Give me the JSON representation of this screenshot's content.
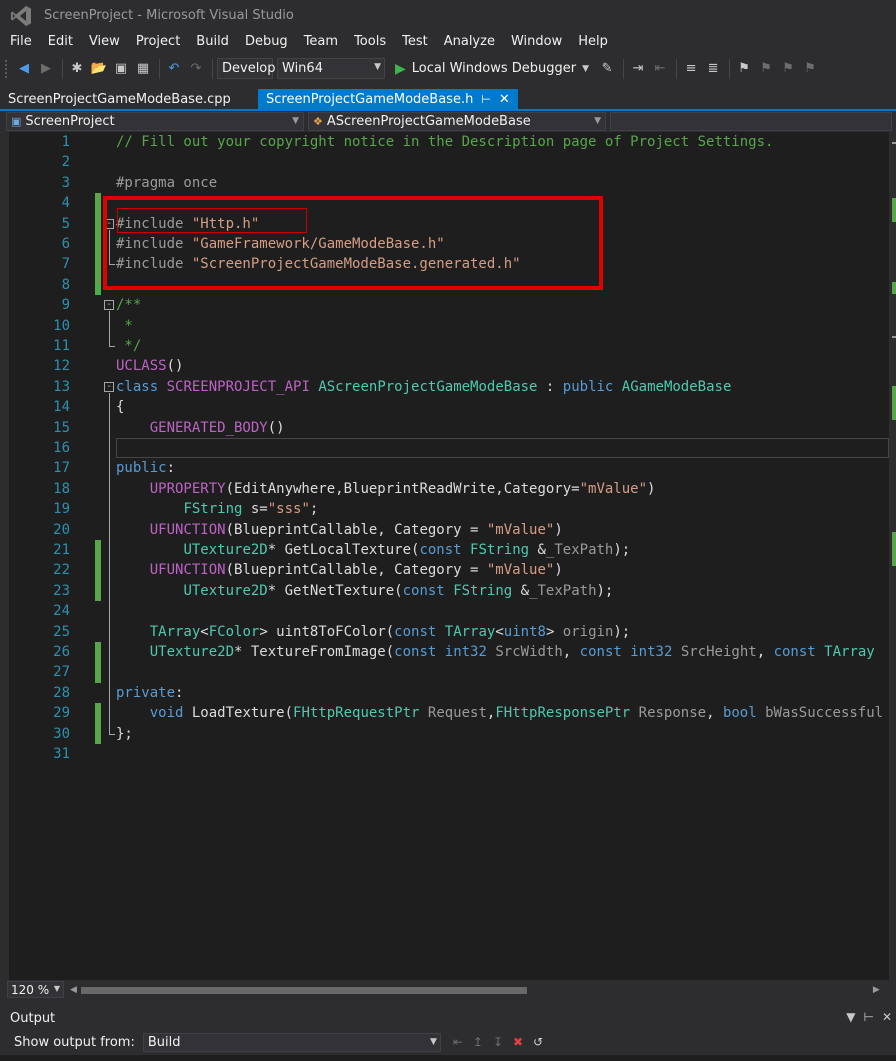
{
  "window": {
    "title": "ScreenProject - Microsoft Visual Studio"
  },
  "menu": [
    "File",
    "Edit",
    "View",
    "Project",
    "Build",
    "Debug",
    "Team",
    "Tools",
    "Test",
    "Analyze",
    "Window",
    "Help"
  ],
  "toolbar": {
    "configuration": "Develop",
    "platform": "Win64",
    "debugger_label": "Local Windows Debugger"
  },
  "tabs": {
    "inactive": "ScreenProjectGameModeBase.cpp",
    "active": "ScreenProjectGameModeBase.h"
  },
  "navigation": {
    "project": "ScreenProject",
    "scope": "AScreenProjectGameModeBase"
  },
  "editor": {
    "zoom": "120 %",
    "line_numbers": [
      "1",
      "2",
      "3",
      "4",
      "5",
      "6",
      "7",
      "8",
      "9",
      "10",
      "11",
      "12",
      "13",
      "14",
      "15",
      "16",
      "17",
      "18",
      "19",
      "20",
      "21",
      "22",
      "23",
      "24",
      "25",
      "26",
      "27",
      "28",
      "29",
      "30",
      "31"
    ],
    "lines": [
      [
        [
          "c",
          "// Fill out your copyright notice in the Description page of Project Settings."
        ]
      ],
      [],
      [
        [
          "p",
          "#pragma once"
        ]
      ],
      [],
      [
        [
          "p",
          "#include "
        ],
        [
          "s",
          "\"Http.h\""
        ]
      ],
      [
        [
          "p",
          "#include "
        ],
        [
          "s",
          "\"GameFramework/GameModeBase.h\""
        ]
      ],
      [
        [
          "p",
          "#include "
        ],
        [
          "s",
          "\"ScreenProjectGameModeBase.generated.h\""
        ]
      ],
      [],
      [
        [
          "c",
          "/**"
        ]
      ],
      [
        [
          "c",
          " *"
        ]
      ],
      [
        [
          "c",
          " */"
        ]
      ],
      [
        [
          "m",
          "UCLASS"
        ],
        [
          "d",
          "()"
        ]
      ],
      [
        [
          "k",
          "class"
        ],
        [
          "d",
          " "
        ],
        [
          "m",
          "SCREENPROJECT_API"
        ],
        [
          "d",
          " "
        ],
        [
          "t",
          "AScreenProjectGameModeBase"
        ],
        [
          "d",
          " : "
        ],
        [
          "k",
          "public"
        ],
        [
          "d",
          " "
        ],
        [
          "t",
          "AGameModeBase"
        ]
      ],
      [
        [
          "d",
          "{"
        ]
      ],
      [
        [
          "d",
          "    "
        ],
        [
          "m",
          "GENERATED_BODY"
        ],
        [
          "d",
          "()"
        ]
      ],
      [],
      [
        [
          "k",
          "public"
        ],
        [
          "d",
          ":"
        ]
      ],
      [
        [
          "d",
          "    "
        ],
        [
          "m",
          "UPROPERTY"
        ],
        [
          "d",
          "(EditAnywhere,BlueprintReadWrite,Category="
        ],
        [
          "s",
          "\"mValue\""
        ],
        [
          "d",
          ")"
        ]
      ],
      [
        [
          "d",
          "        "
        ],
        [
          "t",
          "FString"
        ],
        [
          "d",
          " s="
        ],
        [
          "s",
          "\"sss\""
        ],
        [
          "d",
          ";"
        ]
      ],
      [
        [
          "d",
          "    "
        ],
        [
          "m",
          "UFUNCTION"
        ],
        [
          "d",
          "(BlueprintCallable, Category = "
        ],
        [
          "s",
          "\"mValue\""
        ],
        [
          "d",
          ")"
        ]
      ],
      [
        [
          "d",
          "        "
        ],
        [
          "t",
          "UTexture2D"
        ],
        [
          "d",
          "* GetLocalTexture("
        ],
        [
          "k",
          "const"
        ],
        [
          "d",
          " "
        ],
        [
          "t",
          "FString"
        ],
        [
          "d",
          " &"
        ],
        [
          "a",
          "_TexPath"
        ],
        [
          "d",
          ");"
        ]
      ],
      [
        [
          "d",
          "    "
        ],
        [
          "m",
          "UFUNCTION"
        ],
        [
          "d",
          "(BlueprintCallable, Category = "
        ],
        [
          "s",
          "\"mValue\""
        ],
        [
          "d",
          ")"
        ]
      ],
      [
        [
          "d",
          "        "
        ],
        [
          "t",
          "UTexture2D"
        ],
        [
          "d",
          "* GetNetTexture("
        ],
        [
          "k",
          "const"
        ],
        [
          "d",
          " "
        ],
        [
          "t",
          "FString"
        ],
        [
          "d",
          " &"
        ],
        [
          "a",
          "_TexPath"
        ],
        [
          "d",
          ");"
        ]
      ],
      [],
      [
        [
          "d",
          "    "
        ],
        [
          "t",
          "TArray"
        ],
        [
          "d",
          "<"
        ],
        [
          "t",
          "FColor"
        ],
        [
          "d",
          "> uint8ToFColor("
        ],
        [
          "k",
          "const"
        ],
        [
          "d",
          " "
        ],
        [
          "t",
          "TArray"
        ],
        [
          "d",
          "<"
        ],
        [
          "k",
          "uint8"
        ],
        [
          "d",
          "> "
        ],
        [
          "a",
          "origin"
        ],
        [
          "d",
          ");"
        ]
      ],
      [
        [
          "d",
          "    "
        ],
        [
          "t",
          "UTexture2D"
        ],
        [
          "d",
          "* TextureFromImage("
        ],
        [
          "k",
          "const"
        ],
        [
          "d",
          " "
        ],
        [
          "k",
          "int32"
        ],
        [
          "d",
          " "
        ],
        [
          "a",
          "SrcWidth"
        ],
        [
          "d",
          ", "
        ],
        [
          "k",
          "const"
        ],
        [
          "d",
          " "
        ],
        [
          "k",
          "int32"
        ],
        [
          "d",
          " "
        ],
        [
          "a",
          "SrcHeight"
        ],
        [
          "d",
          ", "
        ],
        [
          "k",
          "const"
        ],
        [
          "d",
          " "
        ],
        [
          "t",
          "TArray"
        ]
      ],
      [],
      [
        [
          "k",
          "private"
        ],
        [
          "d",
          ":"
        ]
      ],
      [
        [
          "d",
          "    "
        ],
        [
          "k",
          "void"
        ],
        [
          "d",
          " LoadTexture("
        ],
        [
          "t",
          "FHttpRequestPtr"
        ],
        [
          "d",
          " "
        ],
        [
          "a",
          "Request"
        ],
        [
          "d",
          ","
        ],
        [
          "t",
          "FHttpResponsePtr"
        ],
        [
          "d",
          " "
        ],
        [
          "a",
          "Response"
        ],
        [
          "d",
          ", "
        ],
        [
          "k",
          "bool"
        ],
        [
          "d",
          " "
        ],
        [
          "a",
          "bWasSuccessful"
        ]
      ],
      [
        [
          "d",
          "};"
        ]
      ],
      []
    ]
  },
  "output": {
    "title": "Output",
    "show_from_label": "Show output from:",
    "source": "Build"
  }
}
